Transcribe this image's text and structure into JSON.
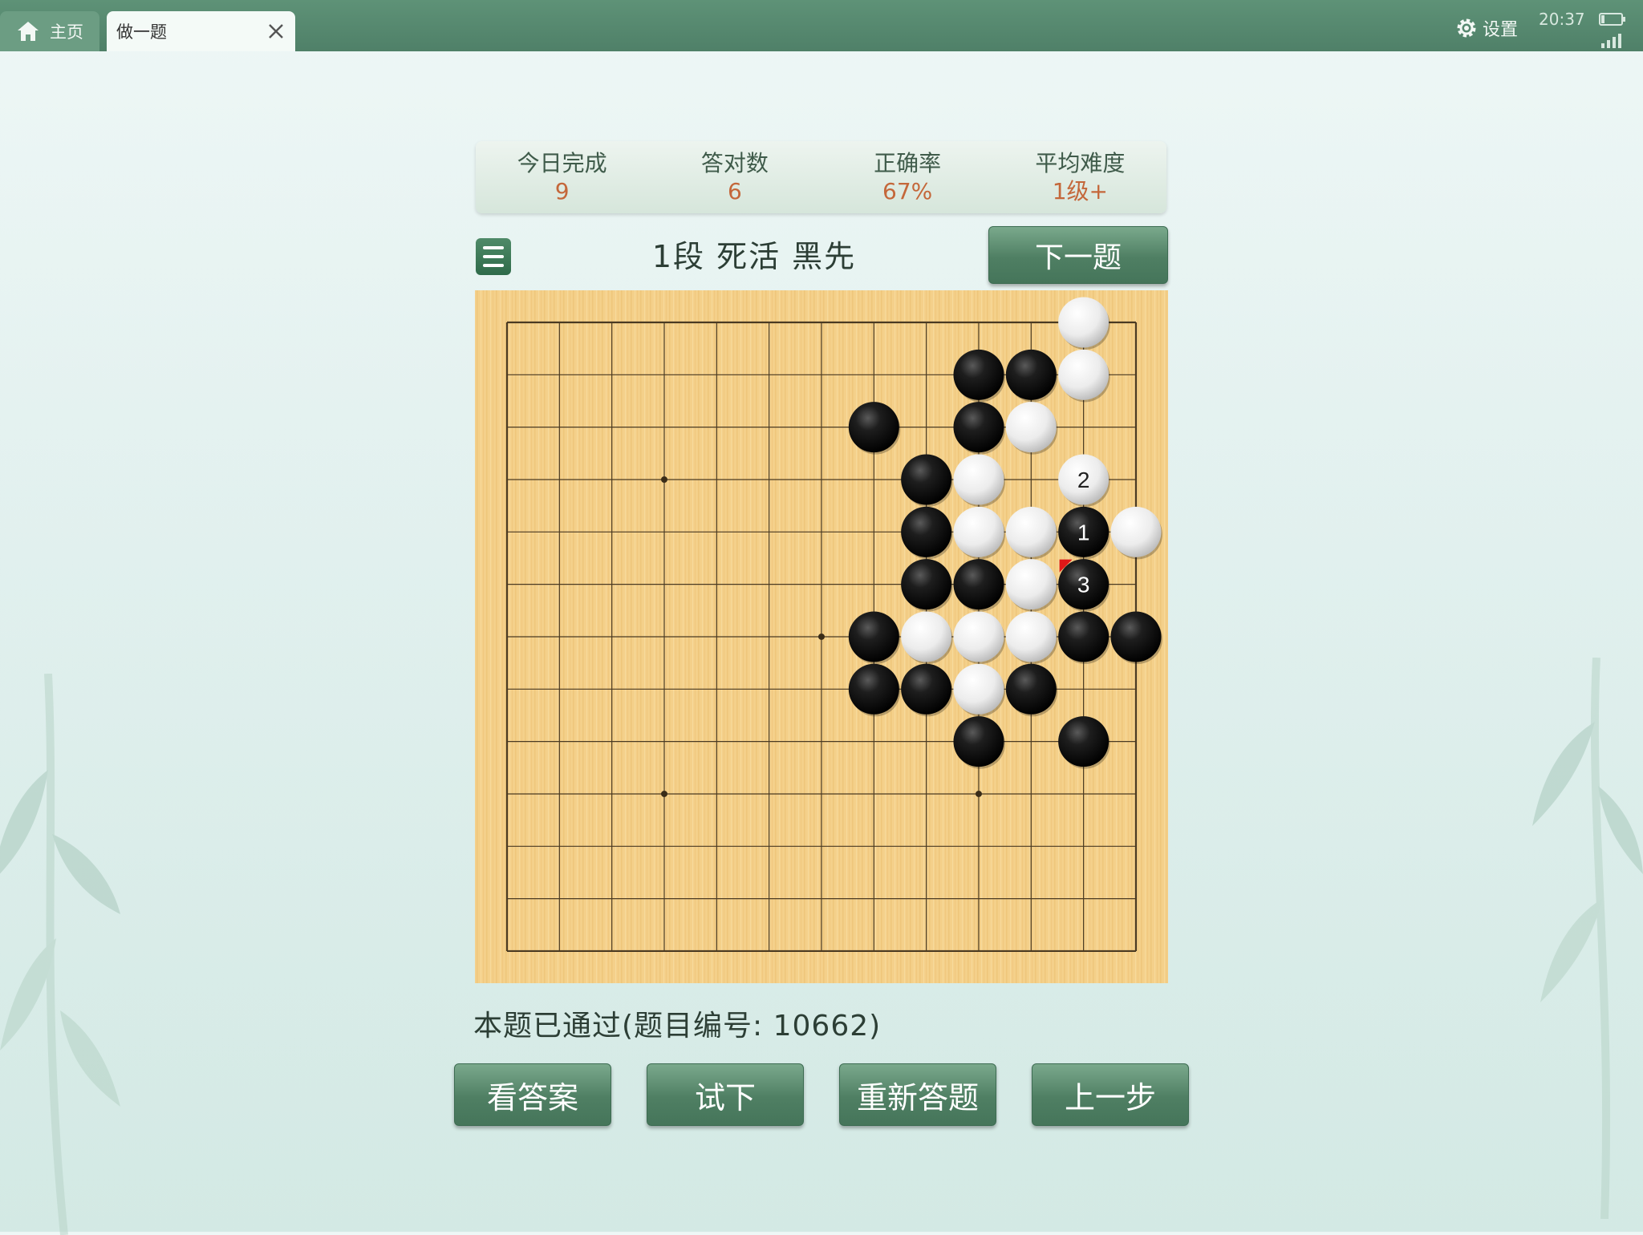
{
  "tabs": {
    "home_label": "主页",
    "active_label": "做一题"
  },
  "status_bar": {
    "settings_label": "设置",
    "time": "20:37"
  },
  "stats": [
    {
      "label": "今日完成",
      "value": "9"
    },
    {
      "label": "答对数",
      "value": "6"
    },
    {
      "label": "正确率",
      "value": "67%"
    },
    {
      "label": "平均难度",
      "value": "1级+"
    }
  ],
  "problem": {
    "title": "1段 死活 黑先",
    "next_label": "下一题"
  },
  "board": {
    "size": 13,
    "star_points": [
      [
        3,
        3
      ],
      [
        6,
        6
      ],
      [
        3,
        9
      ],
      [
        9,
        9
      ]
    ],
    "stones": [
      {
        "c": "W",
        "x": 11,
        "y": 0
      },
      {
        "c": "B",
        "x": 9,
        "y": 1
      },
      {
        "c": "B",
        "x": 10,
        "y": 1
      },
      {
        "c": "W",
        "x": 11,
        "y": 1
      },
      {
        "c": "B",
        "x": 7,
        "y": 2
      },
      {
        "c": "B",
        "x": 9,
        "y": 2
      },
      {
        "c": "W",
        "x": 10,
        "y": 2
      },
      {
        "c": "B",
        "x": 8,
        "y": 3
      },
      {
        "c": "W",
        "x": 9,
        "y": 3
      },
      {
        "c": "W",
        "x": 11,
        "y": 3,
        "n": "2"
      },
      {
        "c": "B",
        "x": 8,
        "y": 4
      },
      {
        "c": "W",
        "x": 9,
        "y": 4
      },
      {
        "c": "W",
        "x": 10,
        "y": 4
      },
      {
        "c": "B",
        "x": 11,
        "y": 4,
        "n": "1"
      },
      {
        "c": "W",
        "x": 12,
        "y": 4
      },
      {
        "c": "B",
        "x": 8,
        "y": 5
      },
      {
        "c": "B",
        "x": 9,
        "y": 5
      },
      {
        "c": "W",
        "x": 10,
        "y": 5
      },
      {
        "c": "B",
        "x": 11,
        "y": 5,
        "n": "3",
        "last": true
      },
      {
        "c": "B",
        "x": 7,
        "y": 6
      },
      {
        "c": "W",
        "x": 8,
        "y": 6
      },
      {
        "c": "W",
        "x": 9,
        "y": 6
      },
      {
        "c": "W",
        "x": 10,
        "y": 6
      },
      {
        "c": "B",
        "x": 11,
        "y": 6
      },
      {
        "c": "B",
        "x": 12,
        "y": 6
      },
      {
        "c": "B",
        "x": 7,
        "y": 7
      },
      {
        "c": "B",
        "x": 8,
        "y": 7
      },
      {
        "c": "W",
        "x": 9,
        "y": 7
      },
      {
        "c": "B",
        "x": 10,
        "y": 7
      },
      {
        "c": "B",
        "x": 9,
        "y": 8
      },
      {
        "c": "B",
        "x": 11,
        "y": 8
      }
    ]
  },
  "result_text": "本题已通过(题目编号: 10662)",
  "actions": {
    "answer": "看答案",
    "try": "试下",
    "restart": "重新答题",
    "undo": "上一步"
  },
  "colors": {
    "header": "#5a8d72",
    "accent": "#c4673a",
    "board": "#f2cd85"
  }
}
